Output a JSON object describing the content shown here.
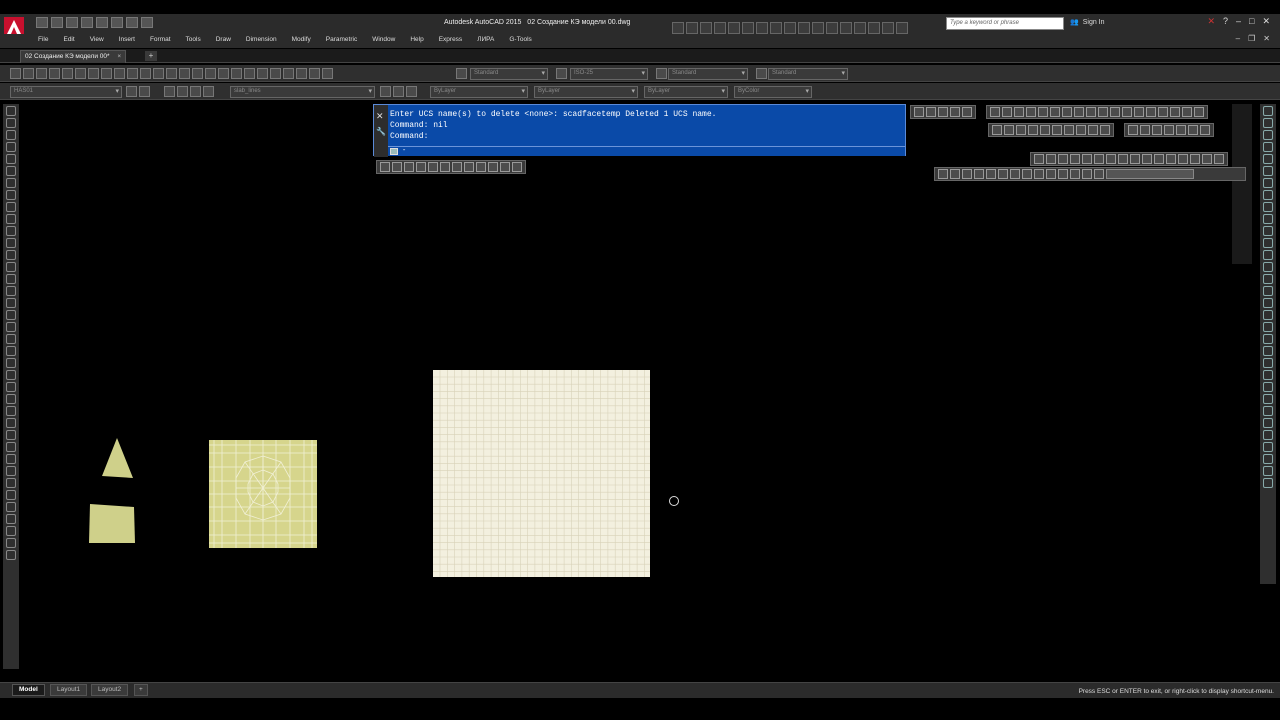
{
  "titlebar": {
    "app_title": "Autodesk AutoCAD 2015",
    "file_title": "02 Создание КЭ модели 00.dwg",
    "search_placeholder": "Type a keyword or phrase",
    "sign_in": "Sign In"
  },
  "menubar": {
    "items": [
      "File",
      "Edit",
      "View",
      "Insert",
      "Format",
      "Tools",
      "Draw",
      "Dimension",
      "Modify",
      "Parametric",
      "Window",
      "Help",
      "Express",
      "ЛИРА",
      "G-Tools"
    ]
  },
  "tabs": {
    "document_tab": "02 Создание КЭ модели 00*",
    "close_glyph": "×",
    "new_tab_glyph": "+"
  },
  "toolbar": {
    "text_style": "Standard",
    "dim_style": "ISO-25",
    "table_style": "Standard",
    "multileader_style": "Standard",
    "layer": "HAS01",
    "layer_filter": "slab_lines",
    "color": "ByLayer",
    "linetype": "ByLayer",
    "lineweight": "ByLayer",
    "plot_style": "ByColor"
  },
  "command_window": {
    "lines": [
      "Enter UCS name(s) to delete <none>: scadfacetemp Deleted 1 UCS name.",
      "Command: nil",
      "Command:"
    ],
    "input_value": "",
    "input_marker": "-"
  },
  "layout_tabs": [
    "Model",
    "Layout1",
    "Layout2"
  ],
  "layout_add": "+",
  "status": {
    "message": "Press ESC or ENTER to exit, or right-click to display shortcut-menu."
  },
  "colors": {
    "background": "#000000",
    "face_fill": "#cfd08a",
    "slab_fill": "#f3f0df",
    "command_blue": "#0a4aa8"
  }
}
